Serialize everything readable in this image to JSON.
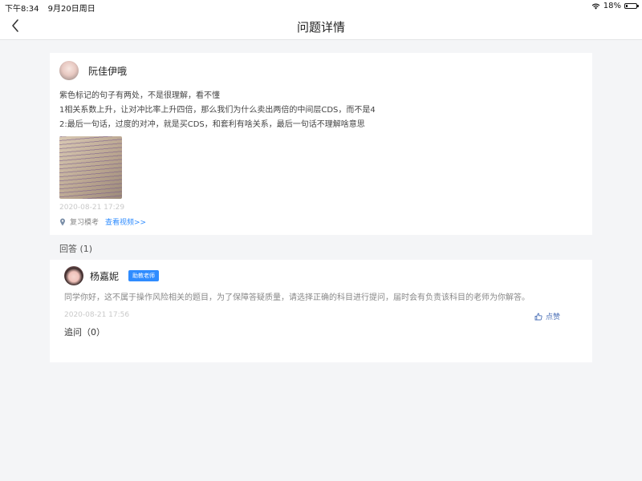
{
  "status_bar": {
    "time": "下午8:34",
    "date": "9月20日周日",
    "battery_percent": "18%",
    "battery_level": 0.18
  },
  "nav": {
    "title": "问题详情",
    "back_icon": "chevron-left-icon"
  },
  "question": {
    "author": "阮佳伊哦",
    "lines": [
      "紫色标记的句子有两处，不是很理解，看不懂",
      "1相关系数上升，让对冲比率上升四倍，那么我们为什么卖出两倍的中间层CDS，而不是4",
      "2:最后一句话，过度的对冲，就是买CDS，和套利有啥关系，最后一句话不理解啥意思"
    ],
    "time": "2020-08-21 17:29",
    "tag": "复习模考",
    "video_link": "查看视频>>"
  },
  "answers": {
    "header": "回答 (1)",
    "items": [
      {
        "author": "杨嘉妮",
        "badge": "助教老师",
        "text": "同学你好，这不属于操作风险相关的题目，为了保障答疑质量，请选择正确的科目进行提问，届时会有负责该科目的老师为你解答。",
        "time": "2020-08-21 17:56",
        "like_label": "点赞",
        "followup_label": "追问（0）"
      }
    ]
  },
  "colors": {
    "accent": "#2f8cff",
    "background": "#f4f5f7"
  }
}
